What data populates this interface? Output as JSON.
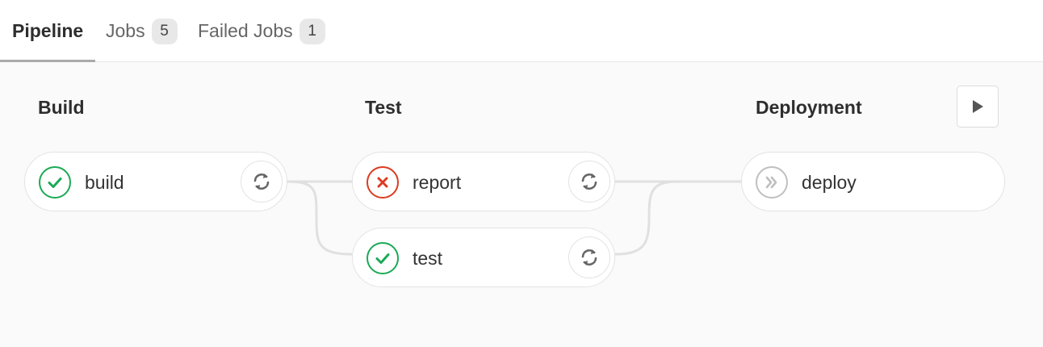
{
  "tabs": [
    {
      "label": "Pipeline"
    },
    {
      "label": "Jobs",
      "count": "5"
    },
    {
      "label": "Failed Jobs",
      "count": "1"
    }
  ],
  "stages": [
    {
      "title": "Build",
      "jobs": [
        {
          "name": "build",
          "status": "success"
        }
      ]
    },
    {
      "title": "Test",
      "jobs": [
        {
          "name": "report",
          "status": "failed"
        },
        {
          "name": "test",
          "status": "success"
        }
      ]
    },
    {
      "title": "Deployment",
      "jobs": [
        {
          "name": "deploy",
          "status": "skipped"
        }
      ]
    }
  ],
  "colors": {
    "success": "#1aaa55",
    "failed": "#db3b21",
    "skipped": "#bfbfbf",
    "connector": "#e0e0e0"
  },
  "icons": {
    "success": "check-icon",
    "failed": "x-icon",
    "skipped": "double-chevron-right-icon",
    "retry": "retry-icon",
    "play": "play-icon"
  }
}
